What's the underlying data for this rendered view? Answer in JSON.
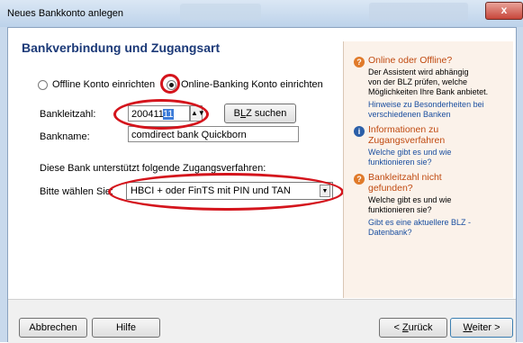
{
  "window": {
    "title": "Neues Bankkonto anlegen",
    "close_glyph": "x"
  },
  "main": {
    "heading": "Bankverbindung und Zugangsart",
    "radio_offline_label": "Offline Konto einrichten",
    "radio_online_label": "Online-Banking Konto einrichten",
    "blz_label": "Bankleitzahl:",
    "blz_value_plain": "200411",
    "blz_value_selected": "11",
    "blz_search_prefix": "B",
    "blz_search_underlined": "L",
    "blz_search_suffix": "Z suchen",
    "bankname_label": "Bankname:",
    "bankname_value": "comdirect bank Quickborn",
    "procedures_text": "Diese Bank unterstützt folgende Zugangsverfahren:",
    "choose_label": "Bitte wählen Sie:",
    "choose_value": "HBCI + oder FinTS mit PIN und TAN"
  },
  "info": {
    "sec1_title": "Online oder Offline?",
    "sec1_text1": "Der Assistent wird abhängig",
    "sec1_text2": "von der BLZ prüfen, welche",
    "sec1_text3": "Möglichkeiten Ihre Bank anbietet.",
    "sec1_link1": "Hinweise zu Besonderheiten bei",
    "sec1_link2": "verschiedenen Banken",
    "sec2_title1": "Informationen zu",
    "sec2_title2": "Zugangsverfahren",
    "sec2_link1": "Welche gibt es und wie",
    "sec2_link2": "funktionieren sie?",
    "sec3_title1": "Bankleitzahl nicht",
    "sec3_title2": "gefunden?",
    "sec3_text1": "Welche gibt es und wie",
    "sec3_text2": "funktionieren sie?",
    "sec3_link1": "Gibt es eine aktuellere BLZ -",
    "sec3_link2": "Datenbank?"
  },
  "footer": {
    "cancel": "Abbrechen",
    "help": "Hilfe",
    "back_prefix": "< ",
    "back_underlined": "Z",
    "back_suffix": "urück",
    "next_underlined": "W",
    "next_suffix": "eiter >"
  },
  "icons": {
    "question": "?",
    "info": "i",
    "spin": "▲▼",
    "dropdown_arrow": "▼"
  }
}
